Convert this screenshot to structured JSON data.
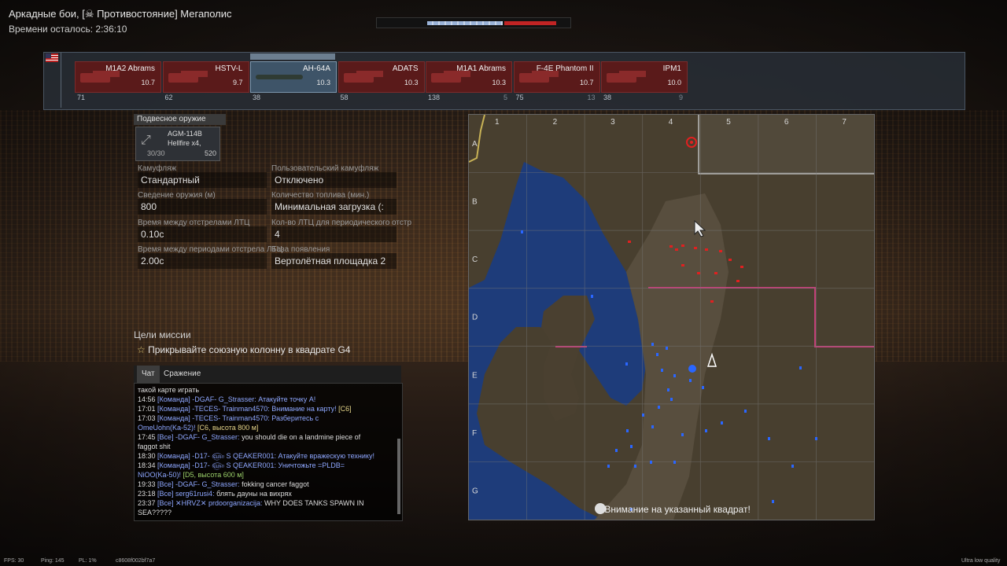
{
  "header": {
    "title": "Аркадные бои, [☠ Противостояние] Мегаполис",
    "timer_label": "Времени осталось:",
    "timer_value": "2:36:10"
  },
  "vehicles": [
    {
      "name": "M1A2 Abrams",
      "br": "10.7",
      "footer_left": "71",
      "footer_right": "",
      "selected": false
    },
    {
      "name": "HSTV-L",
      "br": "9.7",
      "footer_left": "62",
      "footer_right": "",
      "selected": false
    },
    {
      "name": "AH-64A",
      "br": "10.3",
      "footer_left": "38",
      "footer_right": "",
      "selected": true
    },
    {
      "name": "ADATS",
      "br": "10.3",
      "footer_left": "58",
      "footer_right": "",
      "selected": false
    },
    {
      "name": "M1A1 Abrams",
      "br": "10.3",
      "footer_left": "138",
      "footer_right": "5",
      "selected": false
    },
    {
      "name": "F-4E Phantom II",
      "br": "10.7",
      "footer_left": "75",
      "footer_right": "13",
      "selected": false
    },
    {
      "name": "IPM1",
      "br": "10.0",
      "footer_left": "38",
      "footer_right": "9",
      "selected": false
    }
  ],
  "loadout": {
    "section_title": "Подвесное оружие",
    "weapon_name": "AGM-114B",
    "weapon_desc": "Hellfire x4,",
    "weapon_count": "30/30",
    "weapon_price": "520"
  },
  "settings": {
    "camo_label": "Камуфляж",
    "camo_value": "Стандартный",
    "user_camo_label": "Пользовательский камуфляж",
    "user_camo_value": "Отключено",
    "convergence_label": "Сведение оружия (м)",
    "convergence_value": "800",
    "fuel_label": "Количество топлива (мин.)",
    "fuel_value": "Минимальная загрузка (:",
    "flare_interval_label": "Время между отстрелами ЛТЦ",
    "flare_interval_value": "0.10с",
    "flare_count_label": "Кол-во ЛТЦ для периодического отстр",
    "flare_count_value": "4",
    "flare_period_label": "Время между периодами отстрела ЛТЦ",
    "flare_period_value": "2.00с",
    "spawn_label": "База появления",
    "spawn_value": "Вертолётная площадка 2"
  },
  "mission": {
    "title": "Цели миссии",
    "objective": "Прикрывайте союзную колонну в квадрате  G4"
  },
  "chat": {
    "tabs": [
      "Чат",
      "Сражение"
    ],
    "lines": [
      [
        {
          "t": "такой карте играть",
          "c": "t"
        }
      ],
      [
        {
          "t": "14:56 ",
          "c": "t"
        },
        {
          "t": "[Команда] -DGAF- G_Strasser: Атакуйте точку A!",
          "c": "c"
        }
      ],
      [
        {
          "t": "17:01 ",
          "c": "t"
        },
        {
          "t": "[Команда] -TECES- Trainman4570: Внимание на карту! ",
          "c": "c"
        },
        {
          "t": "[C6]",
          "c": "a"
        }
      ],
      [
        {
          "t": "17:03 ",
          "c": "t"
        },
        {
          "t": "[Команда] -TECES- Trainman4570: Разберитесь с",
          "c": "c"
        }
      ],
      [
        {
          "t": "OmeUohn(Ka-52)! ",
          "c": "c"
        },
        {
          "t": "[C6, высота 800 м]",
          "c": "a"
        }
      ],
      [
        {
          "t": "17:45 ",
          "c": "t"
        },
        {
          "t": "[Все] -DGAF- G_Strasser: ",
          "c": "c"
        },
        {
          "t": "you should die on a landmine piece of",
          "c": "t"
        }
      ],
      [
        {
          "t": "faggot shit",
          "c": "t"
        }
      ],
      [
        {
          "t": "18:30 ",
          "c": "t"
        },
        {
          "t": "[Команда] -D17- ௵ S QEAKER001: Атакуйте вражескую технику!",
          "c": "c"
        }
      ],
      [
        {
          "t": "18:34 ",
          "c": "t"
        },
        {
          "t": "[Команда] -D17- ௵ S QEAKER001: Уничтожьте =PLDB=",
          "c": "c"
        }
      ],
      [
        {
          "t": "NiOO(Ka-50)! ",
          "c": "c"
        },
        {
          "t": "[D5, высота 600 м]",
          "c": "g"
        }
      ],
      [
        {
          "t": "19:33 ",
          "c": "t"
        },
        {
          "t": "[Все] -DGAF- G_Strasser: ",
          "c": "c"
        },
        {
          "t": "fokking cancer faggot",
          "c": "t"
        }
      ],
      [
        {
          "t": "23:18 ",
          "c": "t"
        },
        {
          "t": "[Все] serg61rusi4: ",
          "c": "c"
        },
        {
          "t": "блять дауны на вихрях",
          "c": "t"
        }
      ],
      [
        {
          "t": "23:37 ",
          "c": "t"
        },
        {
          "t": "[Все] ✕HRVZ✕ prdoorganizacija: ",
          "c": "c"
        },
        {
          "t": "WHY DOES TANKS SPAWN IN",
          "c": "t"
        }
      ],
      [
        {
          "t": "SEA?????",
          "c": "t"
        }
      ]
    ]
  },
  "map": {
    "columns": [
      "1",
      "2",
      "3",
      "4",
      "5",
      "6",
      "7"
    ],
    "rows": [
      "A",
      "B",
      "C",
      "D",
      "E",
      "F",
      "G"
    ],
    "notice": "Внимание на указанный квадрат!"
  },
  "footer": {
    "fps": "FPS: 30",
    "ping": "Ping: 145",
    "pl": "PL: 1%",
    "id": "c8608f002bf7a7",
    "quality": "Ultra low quality"
  },
  "colors": {
    "ally": "#2a66ff",
    "enemy": "#e02020",
    "water": "#1e3c7a",
    "land": "#4a4030"
  }
}
